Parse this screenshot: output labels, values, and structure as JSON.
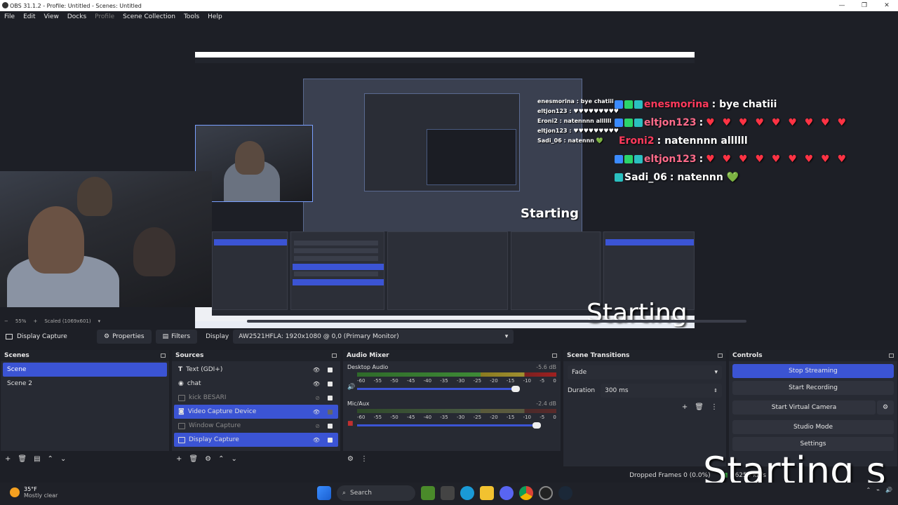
{
  "window": {
    "title": "OBS 31.1.2 - Profile: Untitled - Scenes: Untitled"
  },
  "menu": [
    "File",
    "Edit",
    "View",
    "Docks",
    "Profile",
    "Scene Collection",
    "Tools",
    "Help"
  ],
  "chat": [
    {
      "user": "enesmorina",
      "color": "#ff3a5c",
      "msg": ": bye chatiii",
      "hearts": ""
    },
    {
      "user": "eltjon123",
      "color": "#ff4d77",
      "msg": ":",
      "hearts": "♥ ♥ ♥ ♥ ♥ ♥ ♥ ♥ ♥"
    },
    {
      "user": "Eroni2",
      "color": "#ff3a5c",
      "msg": ": natennnn allllll",
      "hearts": ""
    },
    {
      "user": "eltjon123",
      "color": "#ff4d77",
      "msg": ":",
      "hearts": "♥ ♥ ♥ ♥ ♥ ♥ ♥ ♥ ♥"
    },
    {
      "user": "Sadi_06",
      "color": "#ffffff",
      "msg": ": natennn 💚",
      "hearts": ""
    }
  ],
  "minichat": [
    "enesmorina : bye chatiii",
    "eltjon123 : ♥♥♥♥♥♥♥♥♥",
    "Eroni2 : natennnn allllll",
    "eltjon123 : ♥♥♥♥♥♥♥♥♥",
    "Sadi_06 : natennn 💚"
  ],
  "overlay": {
    "starting": "Starting s"
  },
  "preview": {
    "zoom": "55%",
    "scaled": "Scaled (1069x601)"
  },
  "source_toolbar": {
    "current_source": "Display Capture",
    "properties": "Properties",
    "filters": "Filters",
    "display_label": "Display",
    "display_value": "AW2521HFLA: 1920x1080 @ 0,0 (Primary Monitor)"
  },
  "scenes": {
    "title": "Scenes",
    "items": [
      "Scene",
      "Scene 2"
    ],
    "selected": 0
  },
  "sources": {
    "title": "Sources",
    "items": [
      {
        "name": "Text (GDI+)",
        "visible": true,
        "dim": false,
        "selected": false
      },
      {
        "name": "chat",
        "visible": true,
        "dim": false,
        "selected": false
      },
      {
        "name": "kick BESARI",
        "visible": false,
        "dim": true,
        "selected": false
      },
      {
        "name": "Video Capture Device",
        "visible": true,
        "dim": false,
        "selected": true
      },
      {
        "name": "Window Capture",
        "visible": false,
        "dim": true,
        "selected": false
      },
      {
        "name": "Display Capture",
        "visible": true,
        "dim": false,
        "selected": true
      }
    ]
  },
  "audio_mixer": {
    "title": "Audio Mixer",
    "ticks": [
      "-60",
      "-55",
      "-50",
      "-45",
      "-40",
      "-35",
      "-30",
      "-25",
      "-20",
      "-15",
      "-10",
      "-5",
      "0"
    ],
    "channels": [
      {
        "name": "Desktop Audio",
        "db": "-5.6 dB",
        "muted": false
      },
      {
        "name": "Mic/Aux",
        "db": "-2.4 dB",
        "muted": true
      }
    ]
  },
  "transitions": {
    "title": "Scene Transitions",
    "type": "Fade",
    "duration_label": "Duration",
    "duration": "300 ms"
  },
  "controls": {
    "title": "Controls",
    "buttons": [
      "Stop Streaming",
      "Start Recording",
      "Start Virtual Camera",
      "Studio Mode",
      "Settings"
    ]
  },
  "status": {
    "dropped": "Dropped Frames 0 (0.0%)",
    "kbps": "6259 kb/s"
  },
  "taskbar": {
    "temp": "35°F",
    "weather": "Mostly clear",
    "search": "Search"
  }
}
